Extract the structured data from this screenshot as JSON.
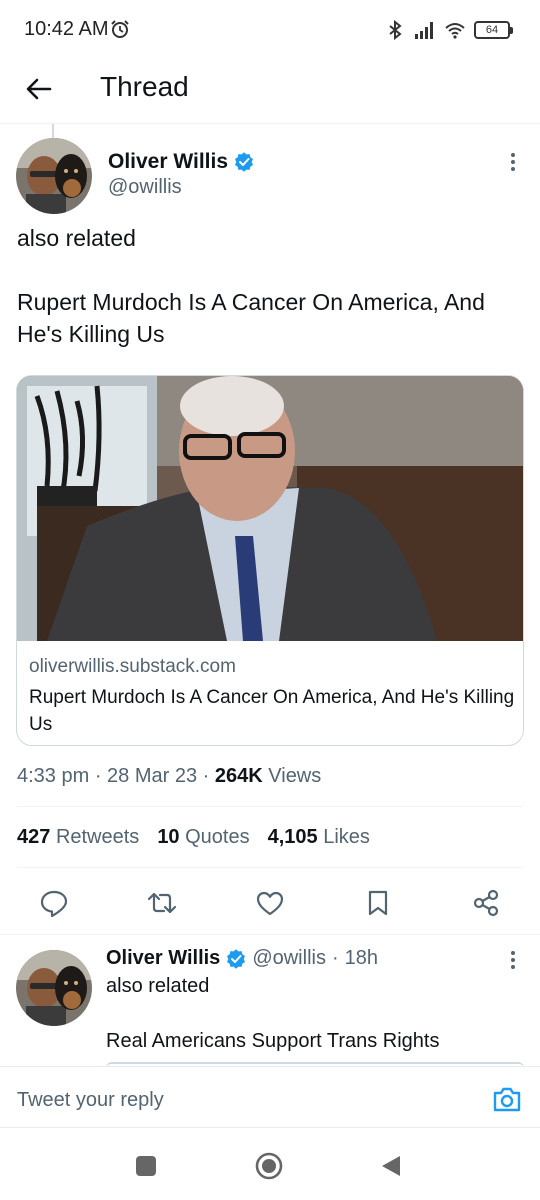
{
  "status_bar": {
    "time": "10:42 AM",
    "battery": "64",
    "icons": [
      "alarm-icon",
      "bluetooth-icon",
      "signal-icon",
      "wifi-icon",
      "battery-icon"
    ]
  },
  "header": {
    "title": "Thread",
    "back_icon": "arrow-left-icon"
  },
  "tweet": {
    "author_name": "Oliver Willis",
    "author_handle": "@owillis",
    "text_line1": "also related",
    "text_line2": "Rupert Murdoch Is A Cancer On America, And He's Killing Us",
    "card": {
      "domain": "oliverwillis.substack.com",
      "title": "Rupert Murdoch Is A Cancer On America, And He's Killing Us"
    },
    "time": "4:33 pm",
    "date": "28 Mar 23",
    "views_count": "264K",
    "views_label": "Views",
    "retweets_count": "427",
    "retweets_label": "Retweets",
    "quotes_count": "10",
    "quotes_label": "Quotes",
    "likes_count": "4,105",
    "likes_label": "Likes",
    "actions": [
      "reply-icon",
      "retweet-icon",
      "like-icon",
      "bookmark-icon",
      "share-icon"
    ]
  },
  "reply": {
    "author_name": "Oliver Willis",
    "author_handle": "@owillis",
    "age": "18h",
    "text_line1": "also related",
    "text_line2": "Real Americans Support Trans Rights"
  },
  "reply_bar": {
    "placeholder": "Tweet your reply"
  },
  "colors": {
    "verified": "#1d9bf0",
    "secondary_text": "#536471",
    "primary_text": "#0f1419"
  }
}
